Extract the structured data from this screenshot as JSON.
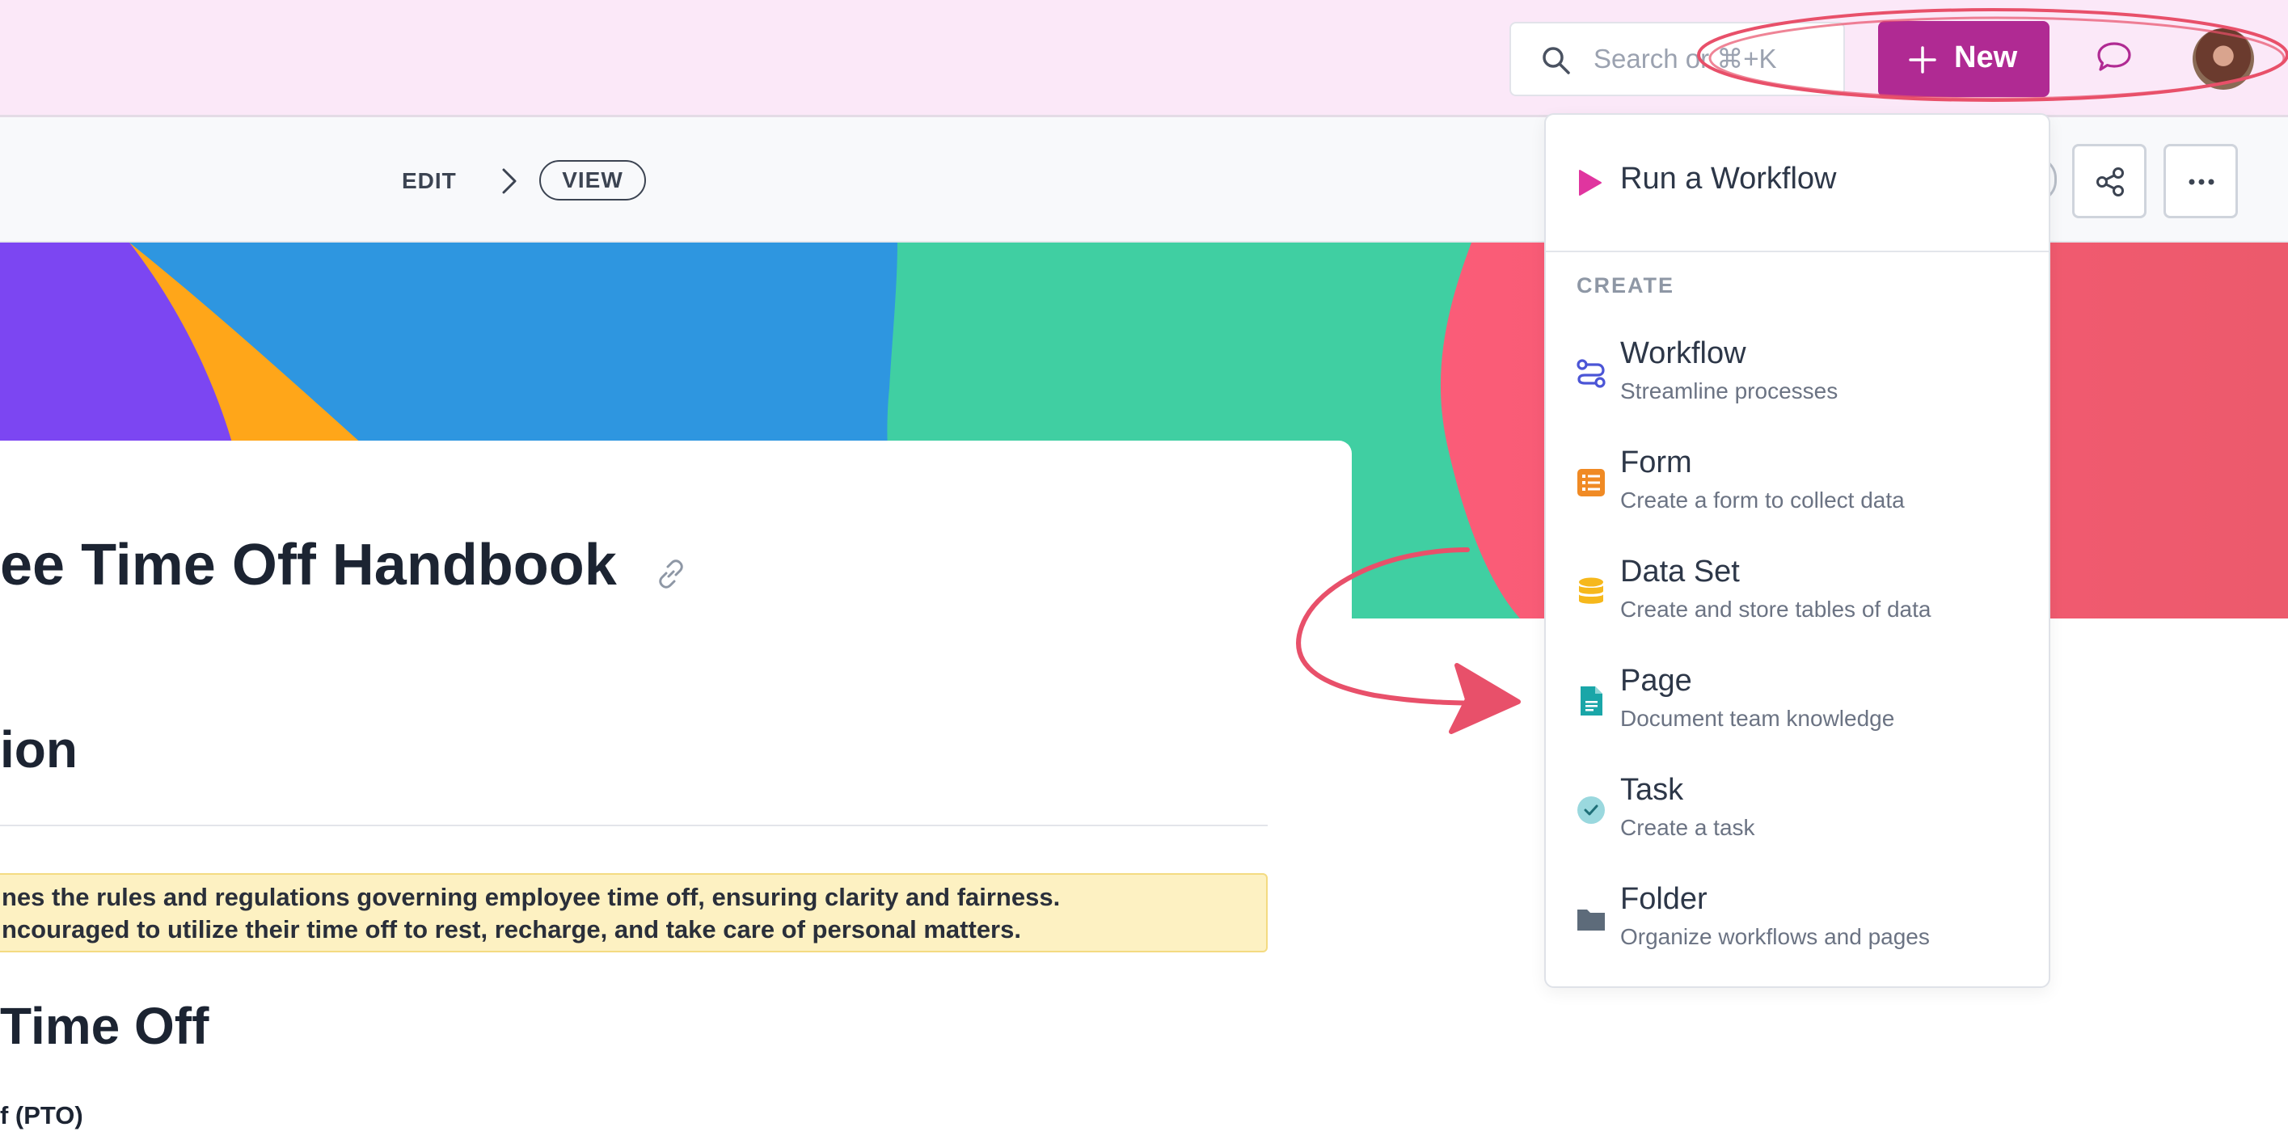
{
  "topbar": {
    "search_placeholder": "Search or ⌘+K",
    "new_label": "New"
  },
  "subheader": {
    "edit_label": "EDIT",
    "view_label": "VIEW"
  },
  "document": {
    "title": "ee Time Off Handbook",
    "section_heading": "ion",
    "callout_line1": "nes the rules and regulations governing employee time off, ensuring clarity and fairness.",
    "callout_line2": "ncouraged to utilize their time off to rest, recharge, and take care of personal matters.",
    "section2_heading": "Time Off",
    "subsection_heading": "f (PTO)"
  },
  "menu": {
    "run_workflow": "Run a Workflow",
    "section_label": "CREATE",
    "items": [
      {
        "title": "Workflow",
        "description": "Streamline processes",
        "icon": "workflow-icon",
        "color": "#4b55d6"
      },
      {
        "title": "Form",
        "description": "Create a form to collect data",
        "icon": "form-icon",
        "color": "#f08a24"
      },
      {
        "title": "Data Set",
        "description": "Create and store tables of data",
        "icon": "dataset-icon",
        "color": "#f6b81c"
      },
      {
        "title": "Page",
        "description": "Document team knowledge",
        "icon": "page-icon",
        "color": "#1aa6a8"
      },
      {
        "title": "Task",
        "description": "Create a task",
        "icon": "task-icon",
        "color": "#9ad8de"
      },
      {
        "title": "Folder",
        "description": "Organize workflows and pages",
        "icon": "folder-icon",
        "color": "#5d6b7a"
      }
    ]
  },
  "colors": {
    "brand": "#b02a93",
    "topbar_bg": "#fbe8f8",
    "annotation": "#e8506a",
    "callout_bg": "#fdf1c2"
  }
}
